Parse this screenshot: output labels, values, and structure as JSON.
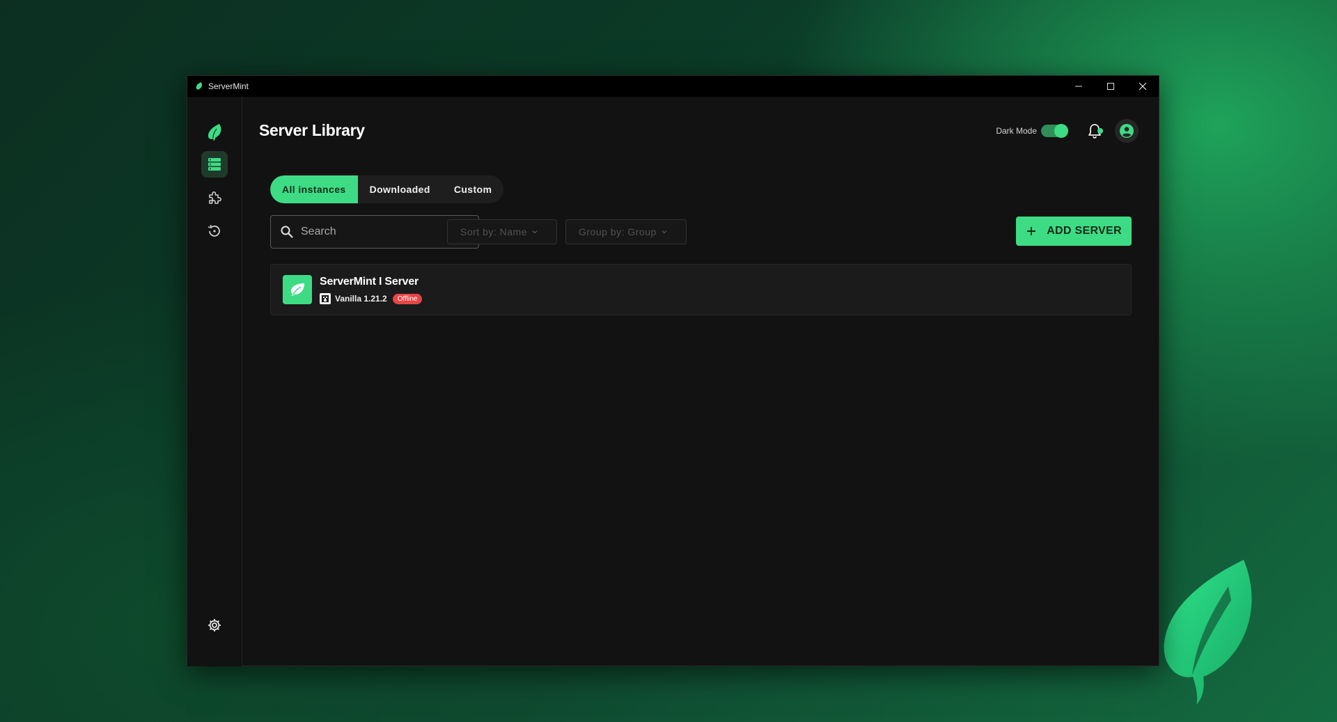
{
  "window": {
    "title": "ServerMint"
  },
  "header": {
    "page_title": "Server Library",
    "dark_mode_label": "Dark Mode",
    "dark_mode_on": true
  },
  "tabs": [
    {
      "label": "All instances",
      "active": true
    },
    {
      "label": "Downloaded",
      "active": false
    },
    {
      "label": "Custom",
      "active": false
    }
  ],
  "search": {
    "placeholder": "Search",
    "value": ""
  },
  "filters": {
    "sort_label": "Sort by: Name",
    "group_label": "Group by: Group"
  },
  "add_button": {
    "label": "ADD SERVER"
  },
  "servers": [
    {
      "name": "ServerMint I Server",
      "version": "Vanilla 1.21.2",
      "status": "Offline"
    }
  ],
  "colors": {
    "accent": "#3ddc84",
    "status_offline": "#e84545",
    "background": "#121212"
  },
  "icons": {
    "sidebar": [
      "servers-icon",
      "puzzle-icon",
      "history-icon",
      "gear-icon"
    ],
    "header": [
      "bell-icon",
      "account-icon"
    ]
  }
}
